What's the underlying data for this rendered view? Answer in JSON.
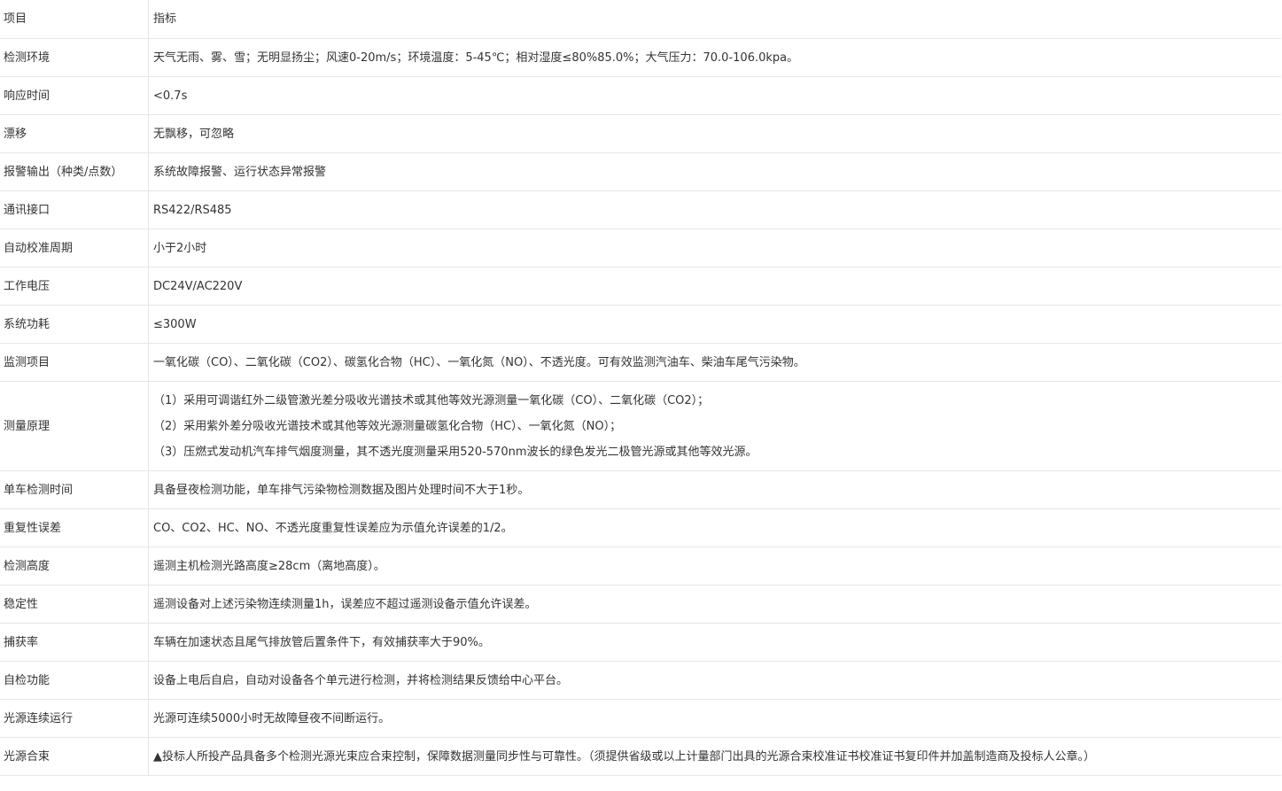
{
  "header": {
    "key": "项目",
    "value": "指标"
  },
  "rows": [
    {
      "key": "检测环境",
      "value": "天气无雨、雾、雪；无明显扬尘；风速0-20m/s；环境温度：5-45℃；相对湿度≤80%85.0%；大气压力：70.0-106.0kpa。"
    },
    {
      "key": "响应时间",
      "value": "<0.7s"
    },
    {
      "key": "漂移",
      "value": "无飘移，可忽略"
    },
    {
      "key": "报警输出（种类/点数）",
      "value": "系统故障报警、运行状态异常报警"
    },
    {
      "key": "通讯接口",
      "value": "RS422/RS485"
    },
    {
      "key": "自动校准周期",
      "value": "小于2小时"
    },
    {
      "key": "工作电压",
      "value": "DC24V/AC220V"
    },
    {
      "key": "系统功耗",
      "value": "≤300W"
    },
    {
      "key": "监测项目",
      "value": "一氧化碳（CO）、二氧化碳（CO2）、碳氢化合物（HC）、一氧化氮（NO）、不透光度。可有效监测汽油车、柴油车尾气污染物。"
    }
  ],
  "principle": {
    "key": "测量原理",
    "lines": [
      "（1）采用可调谐红外二级管激光差分吸收光谱技术或其他等效光源测量一氧化碳（CO）、二氧化碳（CO2）；",
      "（2）采用紫外差分吸收光谱技术或其他等效光源测量碳氢化合物（HC）、一氧化氮（NO）；",
      "（3）压燃式发动机汽车排气烟度测量，其不透光度测量采用520-570nm波长的绿色发光二极管光源或其他等效光源。"
    ]
  },
  "rows2": [
    {
      "key": "单车检测时间",
      "value": "具备昼夜检测功能，单车排气污染物检测数据及图片处理时间不大于1秒。"
    },
    {
      "key": "重复性误差",
      "value": "CO、CO2、HC、NO、不透光度重复性误差应为示值允许误差的1/2。"
    },
    {
      "key": "检测高度",
      "value": "遥测主机检测光路高度≥28cm（离地高度）。"
    },
    {
      "key": "稳定性",
      "value": "遥测设备对上述污染物连续测量1h，误差应不超过遥测设备示值允许误差。"
    },
    {
      "key": "捕获率",
      "value": "车辆在加速状态且尾气排放管后置条件下，有效捕获率大于90%。"
    },
    {
      "key": "自检功能",
      "value": "设备上电后自启，自动对设备各个单元进行检测，并将检测结果反馈给中心平台。"
    },
    {
      "key": "光源连续运行",
      "value": "光源可连续5000小时无故障昼夜不间断运行。"
    },
    {
      "key": "光源合束",
      "value": "▲投标人所投产品具备多个检测光源光束应合束控制，保障数据测量同步性与可靠性。（须提供省级或以上计量部门出具的光源合束校准证书校准证书复印件并加盖制造商及投标人公章。）"
    }
  ]
}
